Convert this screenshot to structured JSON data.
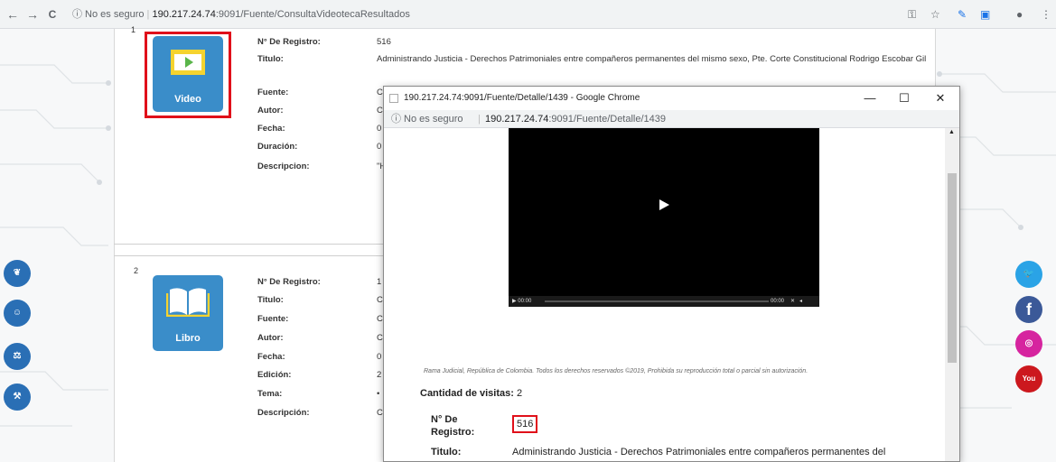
{
  "browser": {
    "back_icon": "←",
    "forward_icon": "→",
    "reload_icon": "C",
    "security_text": "ⓘ No es seguro",
    "url_host": "190.217.24.74",
    "url_rest": ":9091/Fuente/ConsultaVideotecaResultados"
  },
  "results": [
    {
      "number": "1",
      "tile_label": "Video",
      "fields": [
        {
          "label": "N° De Registro:",
          "value": "516"
        },
        {
          "label": "Titulo:",
          "value": "Administrando Justicia - Derechos Patrimoniales entre compañeros permanentes del mismo sexo, Pte. Corte Constitucional Rodrigo Escobar Gil"
        },
        {
          "label": "Fuente:",
          "value": "C"
        },
        {
          "label": "Autor:",
          "value": "C"
        },
        {
          "label": "Fecha:",
          "value": "0"
        },
        {
          "label": "Duración:",
          "value": "0"
        },
        {
          "label": "Descripcion:",
          "value": "\"H"
        }
      ]
    },
    {
      "number": "2",
      "tile_label": "Libro",
      "fields": [
        {
          "label": "N° De Registro:",
          "value": "1"
        },
        {
          "label": "Titulo:",
          "value": "C"
        },
        {
          "label": "Fuente:",
          "value": "C"
        },
        {
          "label": "Autor:",
          "value": "C"
        },
        {
          "label": "Fecha:",
          "value": "0"
        },
        {
          "label": "Edición:",
          "value": "2"
        },
        {
          "label": "Tema:",
          "value": "•"
        },
        {
          "label": "Descripción:",
          "value": "C"
        }
      ]
    }
  ],
  "popup": {
    "title": "190.217.24.74:9091/Fuente/Detalle/1439 - Google Chrome",
    "security_text": "ⓘ No es seguro",
    "url_host": "190.217.24.74",
    "url_rest": ":9091/Fuente/Detalle/1439",
    "minimize": "—",
    "maximize": "☐",
    "close": "✕",
    "video_time_left": "▶ 00:00",
    "video_time_right": "00:00",
    "footer": "Rama Judicial, República de Colombia. Todos los derechos reservados ©2019, Prohibida su reproducción total o parcial sin autorización.",
    "visits_label": "Cantidad de visitas:",
    "visits_value": "2",
    "registro_label": "N° De Registro:",
    "registro_value": "516",
    "titulo_label": "Titulo:",
    "titulo_value": "Administrando Justicia - Derechos Patrimoniales entre compañeros permanentes del"
  },
  "colors": {
    "tile": "#3a8dc9",
    "highlight": "#e0101a",
    "twitter": "#2aa3e6",
    "facebook": "#3b5998",
    "instagram": "#d6249f",
    "youtube": "#cc181e"
  },
  "side_icons_left": [
    "leaf-icon",
    "reader-icon",
    "scales-icon",
    "gavel-icon"
  ],
  "side_icons_right": [
    "twitter-icon",
    "facebook-icon",
    "instagram-icon",
    "youtube-icon"
  ]
}
